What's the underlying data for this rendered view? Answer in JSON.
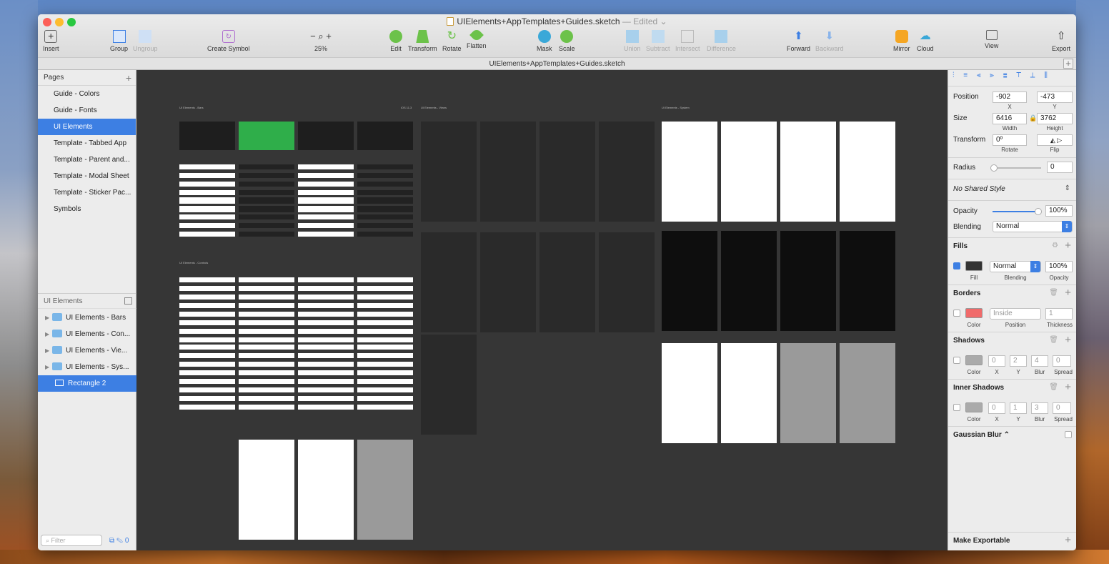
{
  "window": {
    "file_title": "UIElements+AppTemplates+Guides.sketch",
    "edited": "— Edited ⌄",
    "subtitle": "UIElements+AppTemplates+Guides.sketch"
  },
  "toolbar": {
    "insert": "Insert",
    "group": "Group",
    "ungroup": "Ungroup",
    "create_symbol": "Create Symbol",
    "zoom": "25%",
    "edit": "Edit",
    "transform": "Transform",
    "rotate": "Rotate",
    "flatten": "Flatten",
    "mask": "Mask",
    "scale": "Scale",
    "union": "Union",
    "subtract": "Subtract",
    "intersect": "Intersect",
    "difference": "Difference",
    "forward": "Forward",
    "backward": "Backward",
    "mirror": "Mirror",
    "cloud": "Cloud",
    "view": "View",
    "export": "Export"
  },
  "pages": {
    "header": "Pages",
    "items": [
      "Guide - Colors",
      "Guide - Fonts",
      "UI Elements",
      "Template - Tabbed App",
      "Template - Parent and...",
      "Template - Modal Sheet",
      "Template - Sticker Pac...",
      "Symbols"
    ],
    "selected": "UI Elements"
  },
  "layers": {
    "header": "UI Elements",
    "items": [
      "UI Elements - Bars",
      "UI Elements - Con...",
      "UI Elements - Vie...",
      "UI Elements - Sys...",
      "Rectangle 2"
    ],
    "filter_placeholder": "Filter",
    "count": "0"
  },
  "canvas": {
    "labels": {
      "bars": "UI Elements - Bars",
      "views": "UI Elements - Views",
      "system": "UI Elements - System",
      "controls": "UI Elements - Controls",
      "ios": "iOS 11.3"
    }
  },
  "inspector": {
    "position": {
      "label": "Position",
      "x": "-902",
      "y": "-473",
      "x_label": "X",
      "y_label": "Y"
    },
    "size": {
      "label": "Size",
      "w": "6416",
      "h": "3762",
      "w_label": "Width",
      "h_label": "Height"
    },
    "transform": {
      "label": "Transform",
      "rotate": "0º",
      "rotate_label": "Rotate",
      "flip_label": "Flip"
    },
    "radius": {
      "label": "Radius",
      "value": "0"
    },
    "shared_style": "No Shared Style",
    "opacity": {
      "label": "Opacity",
      "value": "100%",
      "level": 1.0
    },
    "blending": {
      "label": "Blending",
      "value": "Normal"
    },
    "fills": {
      "title": "Fills",
      "color": "#333333",
      "blend": "Normal",
      "opacity": "100%",
      "fill_label": "Fill",
      "blend_label": "Blending",
      "opacity_label": "Opacity"
    },
    "borders": {
      "title": "Borders",
      "color": "#f06a6a",
      "position": "Inside",
      "thickness": "1",
      "color_label": "Color",
      "position_label": "Position",
      "thickness_label": "Thickness"
    },
    "shadows": {
      "title": "Shadows",
      "x": "0",
      "y": "2",
      "blur": "4",
      "spread": "0",
      "labels": [
        "Color",
        "X",
        "Y",
        "Blur",
        "Spread"
      ]
    },
    "inner_shadows": {
      "title": "Inner Shadows",
      "x": "0",
      "y": "1",
      "blur": "3",
      "spread": "0",
      "labels": [
        "Color",
        "X",
        "Y",
        "Blur",
        "Spread"
      ]
    },
    "gaussian_blur": "Gaussian Blur ⌃",
    "make_exportable": "Make Exportable"
  }
}
